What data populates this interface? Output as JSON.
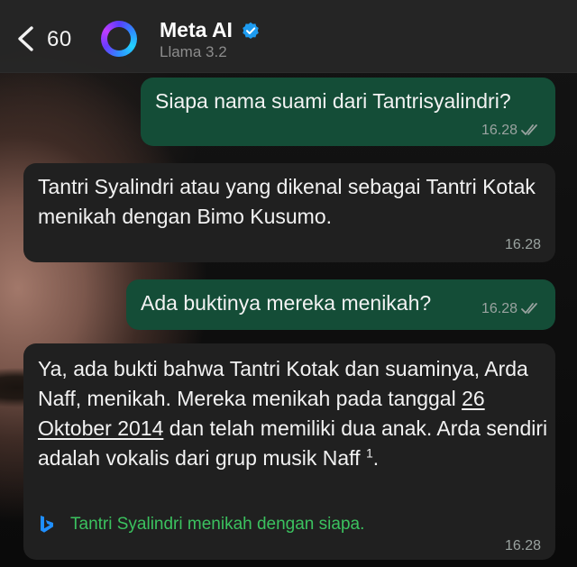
{
  "header": {
    "back_count": "60",
    "name": "Meta AI",
    "subtitle": "Llama 3.2",
    "icons": [
      "back-chevron-icon",
      "meta-ai-ring-icon",
      "verified-badge-icon"
    ]
  },
  "messages": [
    {
      "side": "outgoing",
      "text": "Siapa nama suami dari Tantrisyalindri?",
      "time": "16.28"
    },
    {
      "side": "incoming",
      "text": "Tantri Syalindri atau yang dikenal sebagai Tantri Kotak menikah dengan Bimo Kusumo.",
      "time": "16.28"
    },
    {
      "side": "outgoing",
      "text": "Ada buktinya mereka menikah?",
      "time": "16.28"
    },
    {
      "side": "incoming",
      "text_before": "Ya, ada bukti bahwa Tantri Kotak dan suaminya, Arda Naff, menikah. Mereka menikah pada tanggal ",
      "link_date": "26 Oktober 2014",
      "text_after": " dan telah memiliki dua anak. Arda sendiri adalah vokalis dari grup musik Naff ",
      "footnote": "1",
      "text_end": ".",
      "source_text": "Tantri Syalindri menikah dengan siapa.",
      "source_icon": "bing-icon",
      "time": "16.28"
    }
  ],
  "colors": {
    "outgoing_bubble": "#144d37",
    "incoming_bubble": "#202020",
    "link_green": "#3bc25f",
    "header_bg": "#262626"
  }
}
